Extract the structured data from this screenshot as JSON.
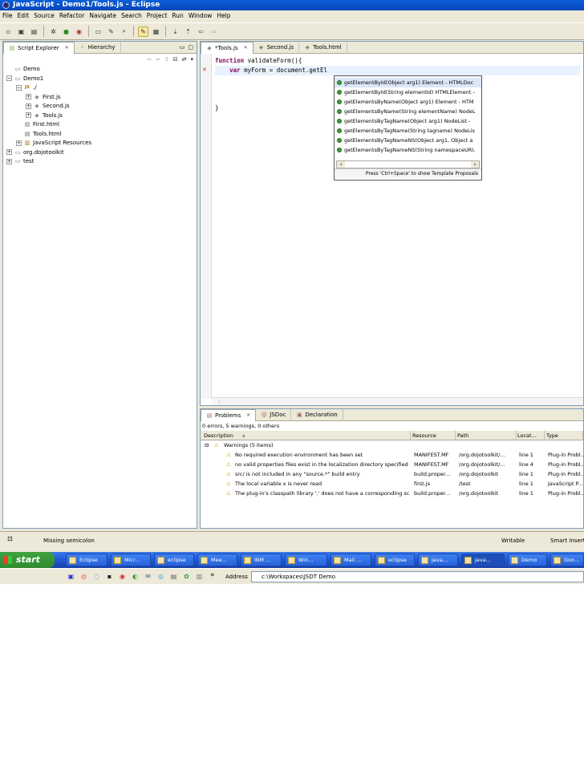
{
  "window": {
    "title": "JavaScript - Demo1/Tools.js - Eclipse"
  },
  "menu": [
    "File",
    "Edit",
    "Source",
    "Refactor",
    "Navigate",
    "Search",
    "Project",
    "Run",
    "Window",
    "Help"
  ],
  "explorer": {
    "tabs": [
      {
        "label": "Script Explorer",
        "icon": "script-explorer-icon"
      },
      {
        "label": "Hierarchy",
        "icon": "hierarchy-icon"
      }
    ],
    "tree": [
      {
        "label": "Demo",
        "indent": 0,
        "expander": "",
        "icon": "folder-icon"
      },
      {
        "label": "Demo1",
        "indent": 0,
        "expander": "−",
        "icon": "folder-icon"
      },
      {
        "label": "./",
        "indent": 1,
        "expander": "−",
        "icon": "js-package-icon"
      },
      {
        "label": "First.js",
        "indent": 2,
        "expander": "+",
        "icon": "js-file-icon"
      },
      {
        "label": "Second.js",
        "indent": 2,
        "expander": "+",
        "icon": "js-file-icon"
      },
      {
        "label": "Tools.js",
        "indent": 2,
        "expander": "+",
        "icon": "js-file-icon"
      },
      {
        "label": "First.html",
        "indent": 1,
        "expander": "",
        "icon": "html-file-icon"
      },
      {
        "label": "Tools.html",
        "indent": 1,
        "expander": "",
        "icon": "html-file-icon"
      },
      {
        "label": "JavaScript Resources",
        "indent": 1,
        "expander": "+",
        "icon": "library-icon"
      },
      {
        "label": "org.dojotoolkit",
        "indent": 0,
        "expander": "+",
        "icon": "folder-icon"
      },
      {
        "label": "test",
        "indent": 0,
        "expander": "+",
        "icon": "folder-icon"
      }
    ]
  },
  "editor": {
    "tabs": [
      {
        "label": "*Tools.js",
        "active": true
      },
      {
        "label": "Second.js",
        "active": false
      },
      {
        "label": "Tools.html",
        "active": false
      }
    ],
    "lines": [
      "function validateForm(){",
      "    var myForm = document.getEl",
      "",
      "",
      "",
      "}"
    ]
  },
  "assist": {
    "items": [
      "getElementById(Object arg1)  Element - HTMLDoc",
      "getElementById(String elementId)  HTMLElement -",
      "getElementsByName(Object arg1)  Element - HTM",
      "getElementsByName(String elementName)  NodeL",
      "getElementsByTagName(Object arg1)  NodeList -",
      "getElementsByTagName(String tagname)  NodeLis",
      "getElementsByTagNameNS(Object arg1, Object a",
      "getElementsByTagNameNS(String namespaceURI,"
    ],
    "footer": "Press 'Ctrl+Space' to show Template Proposals"
  },
  "problems": {
    "tabs": [
      {
        "label": "Problems"
      },
      {
        "label": "JSDoc"
      },
      {
        "label": "Declaration"
      }
    ],
    "summary": "0 errors, 5 warnings, 0 others",
    "columns": [
      "Description",
      "Resource",
      "Path",
      "Locat...",
      "Type"
    ],
    "group": "Warnings (5 items)",
    "rows": [
      [
        "No required execution environment has been set",
        "MANIFEST.MF",
        "/org.dojotoolkit/...",
        "line 1",
        "Plug-in Probl..."
      ],
      [
        "no valid properties files exist in the localization directory specified",
        "MANIFEST.MF",
        "/org.dojotoolkit/...",
        "line 4",
        "Plug-in Probl..."
      ],
      [
        "src/ is not included in any \"source.*\" build entry",
        "build.proper...",
        "/org.dojotoolkit",
        "line 1",
        "Plug-in Probl..."
      ],
      [
        "The local variable x is never read",
        "first.js",
        "/test",
        "line 1",
        "JavaScript P..."
      ],
      [
        "The plug-in's classpath library '.' does not have a corresponding sc",
        "build.proper...",
        "/org.dojotoolkit",
        "line 1",
        "Plug-in Probl..."
      ]
    ]
  },
  "status": {
    "message": "Missing semicolon",
    "writable": "Writable",
    "insert": "Smart Insert"
  },
  "taskbar": {
    "start": "start",
    "tasks": [
      "Eclipse",
      "Micr...",
      "eclipse",
      "Mee...",
      "IBM ...",
      "Win...",
      "Mail ...",
      "eclipse",
      "Java...",
      "Java...",
      "Demo",
      "Goo..."
    ],
    "active_index": 9
  },
  "quicklaunch": {
    "address_label": "Address",
    "address_value": "c:\\Workspaces\\JSDT Demo",
    "chevron": "»"
  }
}
